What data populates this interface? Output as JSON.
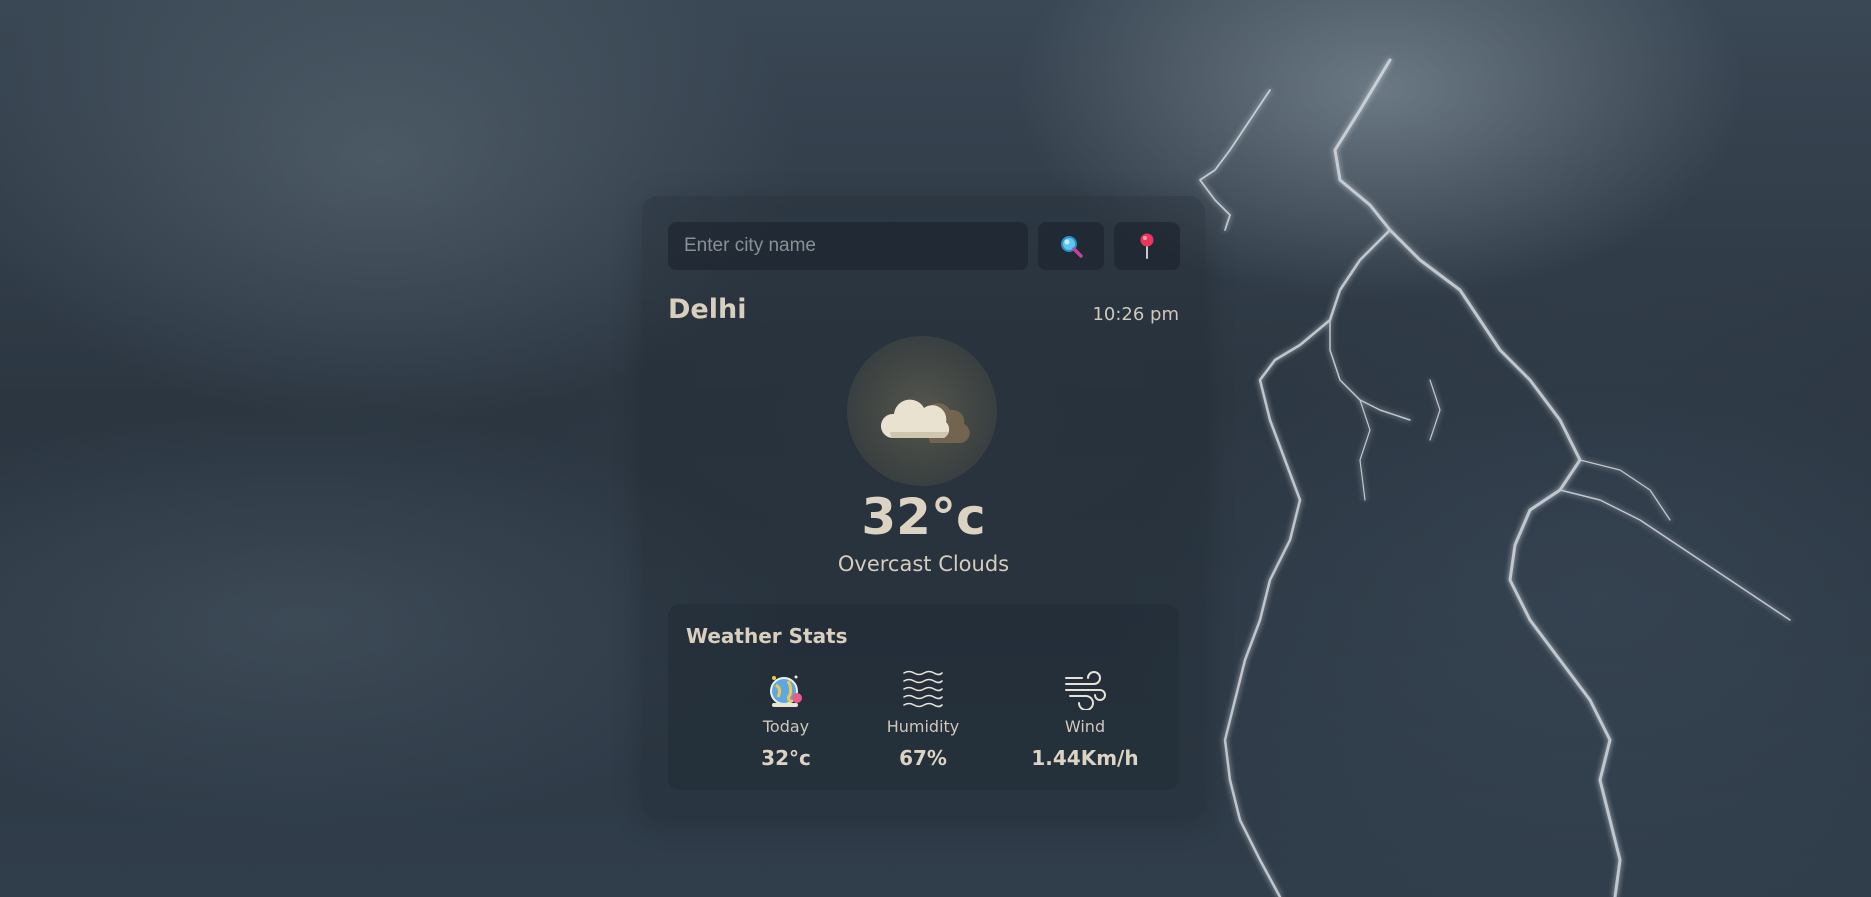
{
  "search": {
    "placeholder": "Enter city name",
    "search_icon": "magnifier-icon",
    "location_icon": "pin-icon"
  },
  "current": {
    "city": "Delhi",
    "time": "10:26 pm",
    "icon": "overcast-cloud-icon",
    "temperature": "32°c",
    "description": "Overcast Clouds"
  },
  "stats": {
    "title": "Weather Stats",
    "items": [
      {
        "label": "Today",
        "value": "32°c",
        "icon": "today-globe-icon"
      },
      {
        "label": "Humidity",
        "value": "67%",
        "icon": "humidity-waves-icon"
      },
      {
        "label": "Wind",
        "value": "1.44Km/h",
        "icon": "wind-icon"
      }
    ]
  },
  "colors": {
    "text": "#ddd3c2",
    "card": "#1e2832",
    "accent_pin": "#e8365d",
    "accent_search": "#3fb6e8"
  }
}
